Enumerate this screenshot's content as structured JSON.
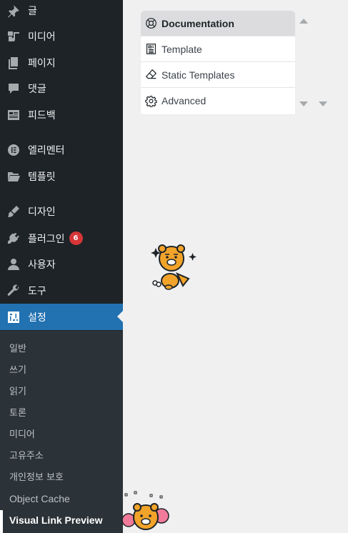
{
  "sidebar": {
    "items": [
      {
        "label": "글",
        "icon": "pin-icon"
      },
      {
        "label": "미디어",
        "icon": "media-icon"
      },
      {
        "label": "페이지",
        "icon": "page-icon"
      },
      {
        "label": "댓글",
        "icon": "comment-icon"
      },
      {
        "label": "피드백",
        "icon": "feedback-icon"
      },
      {
        "label": "엘리멘터",
        "icon": "elementor-icon"
      },
      {
        "label": "템플릿",
        "icon": "folder-icon"
      },
      {
        "label": "디자인",
        "icon": "brush-icon"
      },
      {
        "label": "플러그인",
        "icon": "plugin-icon",
        "badge": "6"
      },
      {
        "label": "사용자",
        "icon": "user-icon"
      },
      {
        "label": "도구",
        "icon": "wrench-icon"
      },
      {
        "label": "설정",
        "icon": "settings-icon",
        "active": true
      }
    ],
    "submenu": [
      {
        "label": "일반"
      },
      {
        "label": "쓰기"
      },
      {
        "label": "읽기"
      },
      {
        "label": "토론"
      },
      {
        "label": "미디어"
      },
      {
        "label": "고유주소"
      },
      {
        "label": "개인정보 보호"
      },
      {
        "label": "Object Cache"
      },
      {
        "label": "Visual Link Preview",
        "current": true
      }
    ]
  },
  "dropdown": {
    "items": [
      {
        "label": "Documentation",
        "icon": "lifebuoy-icon"
      },
      {
        "label": "Template",
        "icon": "template-icon"
      },
      {
        "label": "Static Templates",
        "icon": "eraser-icon"
      },
      {
        "label": "Advanced",
        "icon": "gear-icon"
      }
    ]
  },
  "colors": {
    "sidebar_bg": "#1d2327",
    "submenu_bg": "#2c3338",
    "active_bg": "#2271b1",
    "badge_bg": "#d63638",
    "page_bg": "#f0f0f1"
  }
}
